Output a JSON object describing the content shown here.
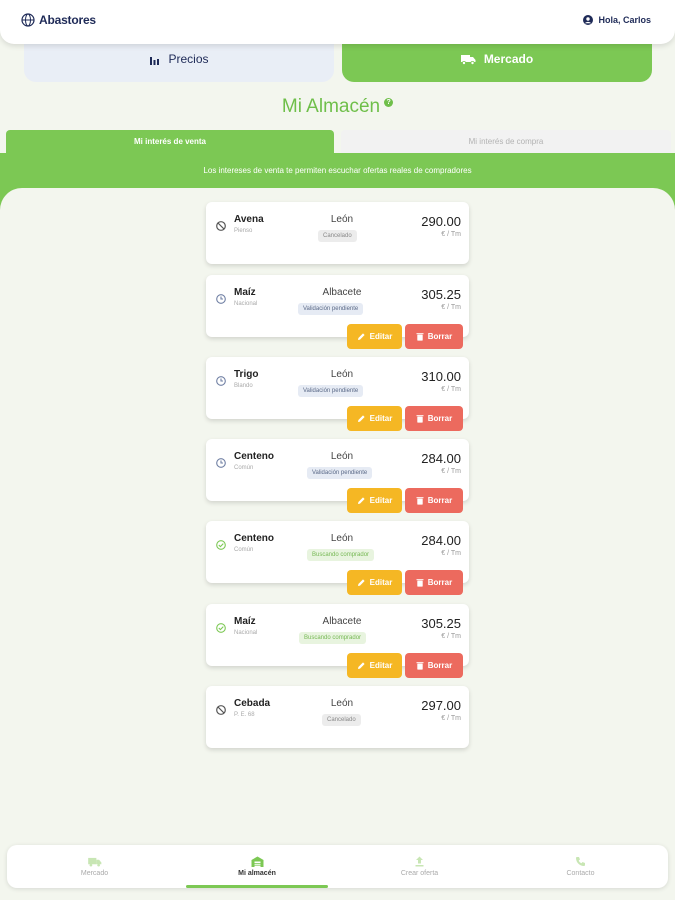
{
  "header": {
    "brand": "Abastores",
    "greeting": "Hola, Carlos"
  },
  "segments": {
    "precios": "Precios",
    "mercado": "Mercado"
  },
  "page_title": "Mi Almacén",
  "subtabs": {
    "venta": "Mi interés de venta",
    "compra": "Mi interés de compra"
  },
  "banner": "Los intereses de venta te permiten escuchar ofertas reales de compradores",
  "actions": {
    "edit": "Editar",
    "delete": "Borrar"
  },
  "cards": [
    {
      "product": "Avena",
      "variety": "Pienso",
      "location": "León",
      "status": "Cancelado",
      "price": "290.00",
      "unit": "€ / Tm"
    },
    {
      "product": "Maíz",
      "variety": "Nacional",
      "location": "Albacete",
      "status": "Validación pendiente",
      "price": "305.25",
      "unit": "€ / Tm"
    },
    {
      "product": "Trigo",
      "variety": "Blando",
      "location": "León",
      "status": "Validación pendiente",
      "price": "310.00",
      "unit": "€ / Tm"
    },
    {
      "product": "Centeno",
      "variety": "Común",
      "location": "León",
      "status": "Validación pendiente",
      "price": "284.00",
      "unit": "€ / Tm"
    },
    {
      "product": "Centeno",
      "variety": "Común",
      "location": "León",
      "status": "Buscando comprador",
      "price": "284.00",
      "unit": "€ / Tm"
    },
    {
      "product": "Maíz",
      "variety": "Nacional",
      "location": "Albacete",
      "status": "Buscando comprador",
      "price": "305.25",
      "unit": "€ / Tm"
    },
    {
      "product": "Cebada",
      "variety": "P. E. 68",
      "location": "León",
      "status": "Cancelado",
      "price": "297.00",
      "unit": "€ / Tm"
    }
  ],
  "bottom_nav": [
    {
      "label": "Mercado",
      "icon": "truck-icon"
    },
    {
      "label": "Mi almacén",
      "icon": "warehouse-icon"
    },
    {
      "label": "Crear oferta",
      "icon": "upload-icon"
    },
    {
      "label": "Contacto",
      "icon": "phone-icon"
    }
  ],
  "colors": {
    "accent": "#7cc854",
    "edit": "#f5b724",
    "delete": "#ec6a5e",
    "navy": "#1e2a57"
  }
}
